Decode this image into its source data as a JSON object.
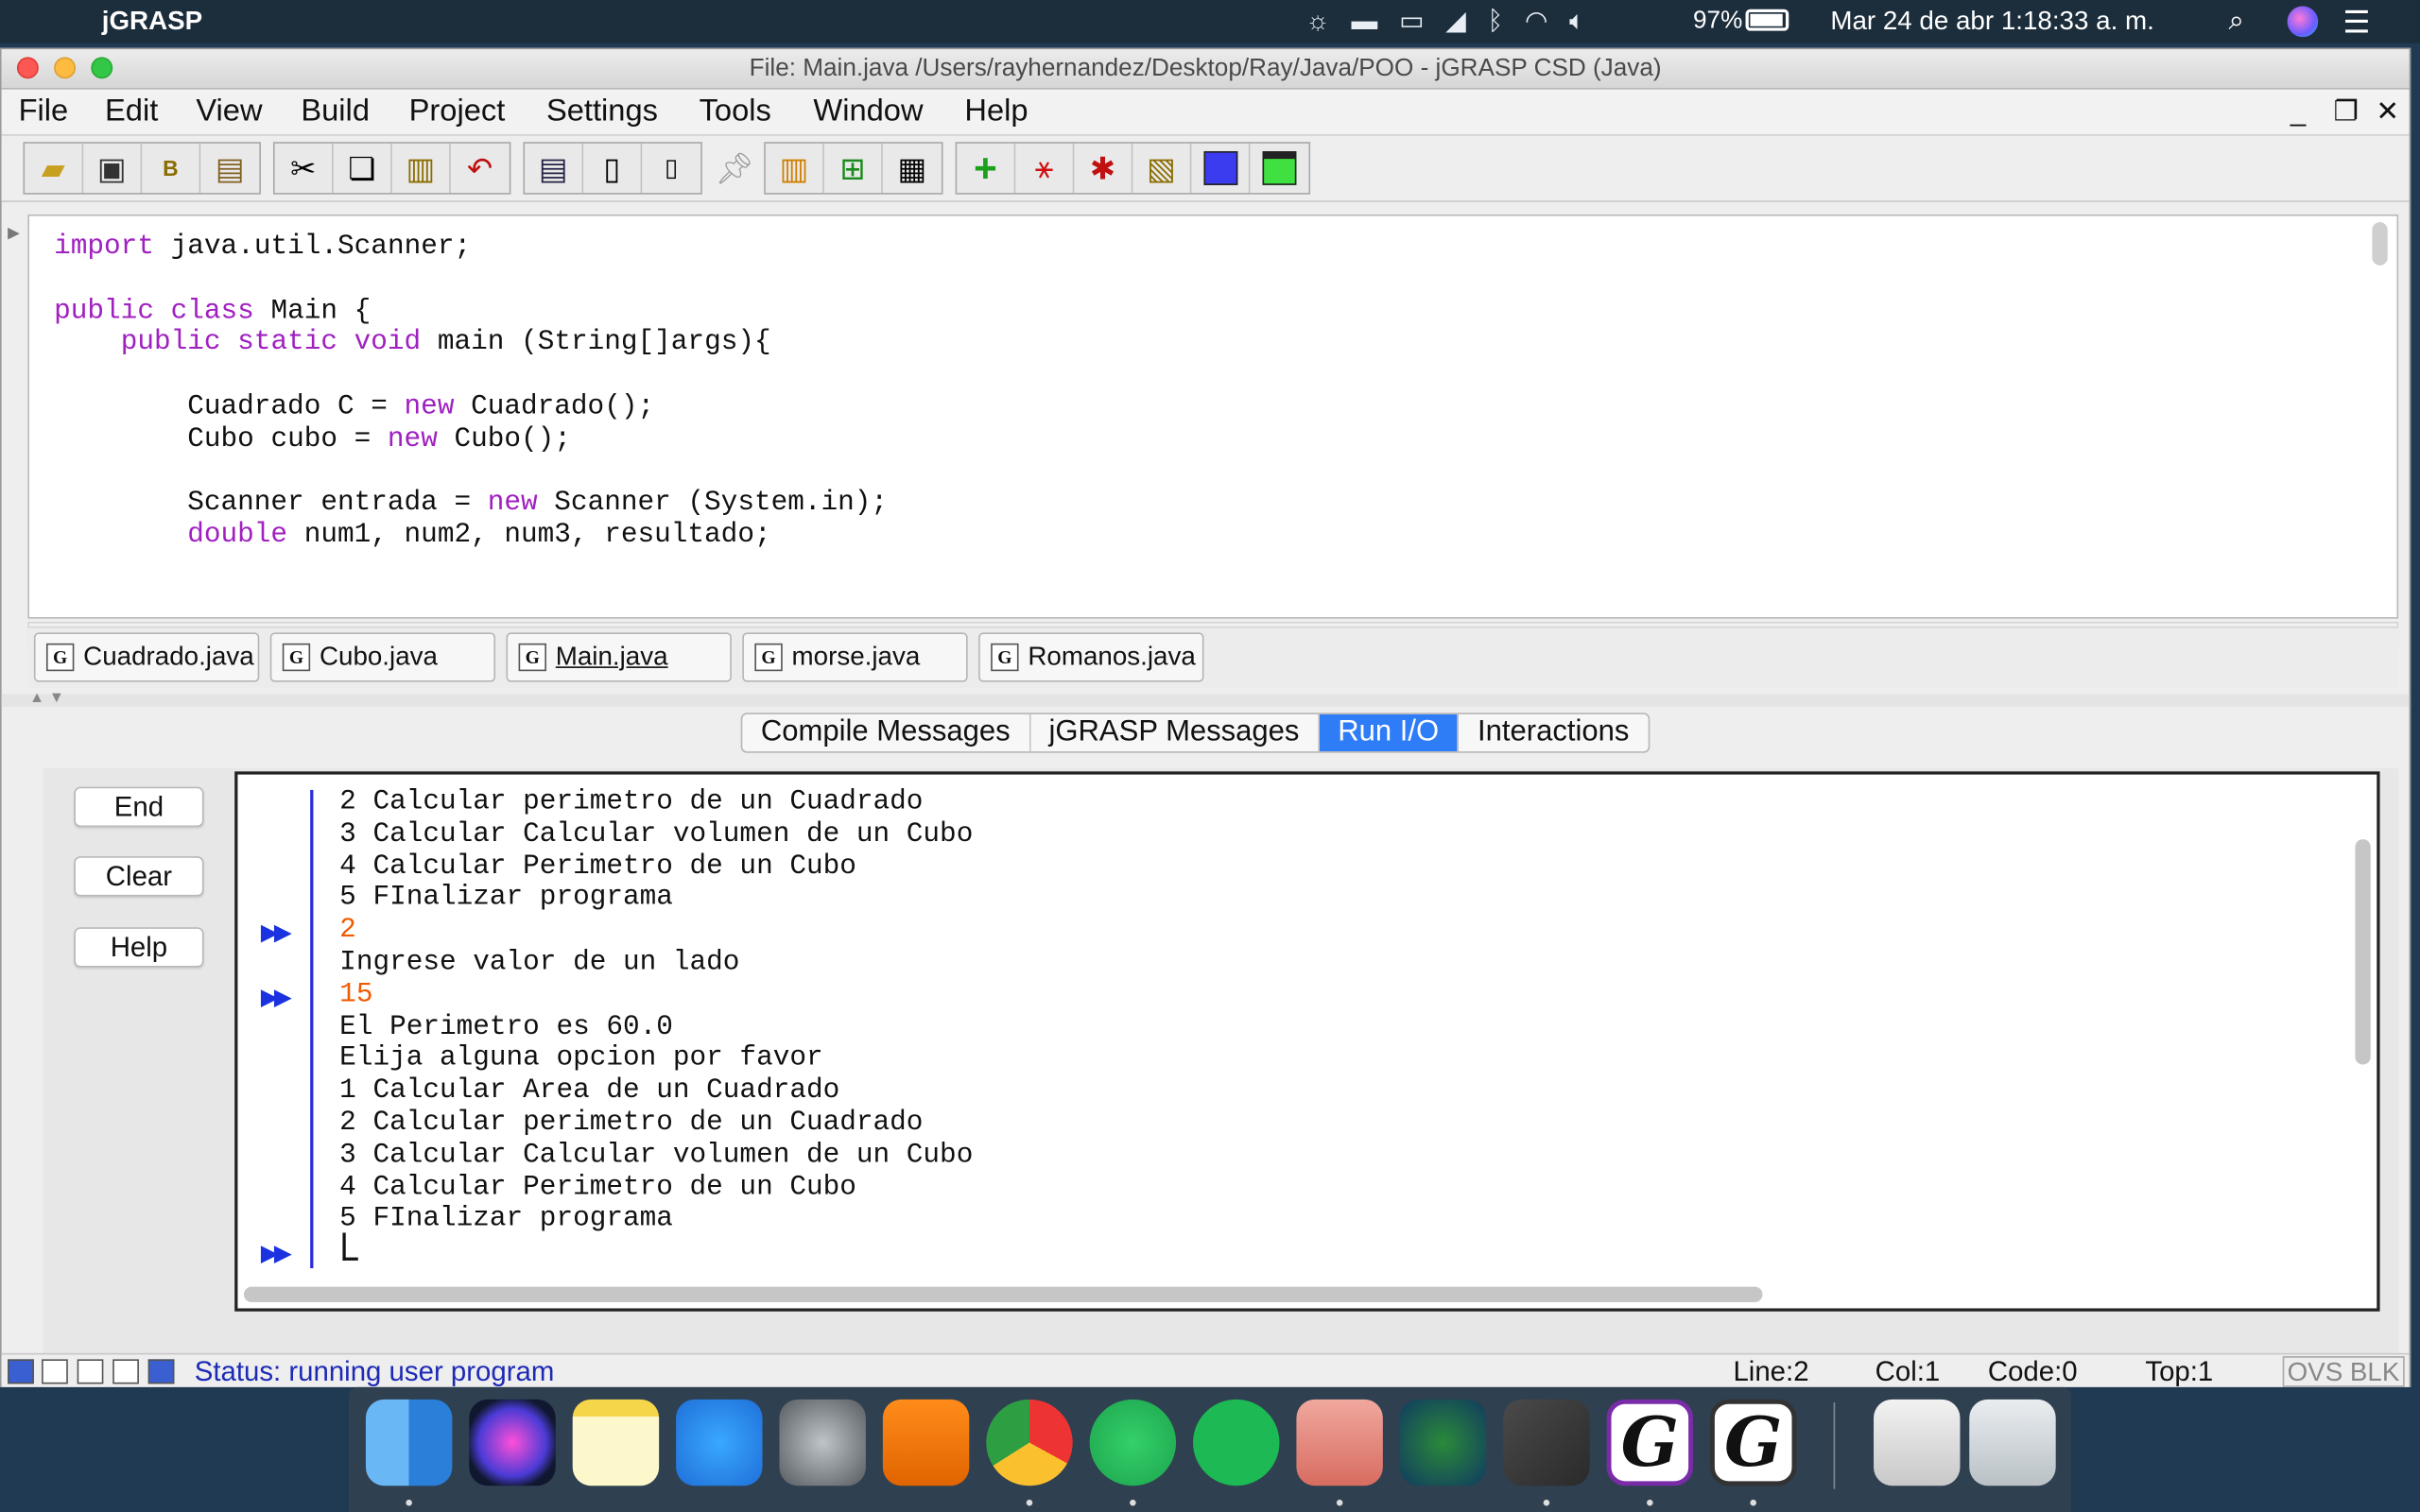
{
  "menubar": {
    "app_name": "jGRASP",
    "battery": "97%",
    "datetime": "Mar 24 de abr  1:18:33 a. m."
  },
  "window": {
    "title": "File: Main.java  /Users/rayhernandez/Desktop/Ray/Java/POO - jGRASP CSD (Java)"
  },
  "menus": [
    "File",
    "Edit",
    "View",
    "Build",
    "Project",
    "Settings",
    "Tools",
    "Window",
    "Help"
  ],
  "toolbar_icons": [
    "open-icon",
    "save-icon",
    "batch-icon",
    "print-icon",
    "cut-icon",
    "copy-icon",
    "paste-icon",
    "undo-icon",
    "generate-csd-icon",
    "remove-csd-icon",
    "line-numbers-icon",
    "pin-icon",
    "chart-icon",
    "uml-icon",
    "book-icon",
    "compile-icon",
    "run-icon",
    "debug-icon",
    "interactions-icon",
    "blue-square-icon",
    "green-window-icon"
  ],
  "editor": {
    "lines": [
      "import java.util.Scanner;",
      "",
      "public class Main {",
      "    public static void main (String[]args){",
      "",
      "        Cuadrado C = new Cuadrado();",
      "        Cubo cubo = new Cubo();",
      "",
      "        Scanner entrada = new Scanner (System.in);",
      "        double num1, num2, num3, resultado;"
    ]
  },
  "file_tabs": [
    "Cuadrado.java",
    "Cubo.java",
    "Main.java",
    "morse.java",
    "Romanos.java"
  ],
  "active_file_tab": "Main.java",
  "message_tabs": [
    "Compile Messages",
    "jGRASP Messages",
    "Run I/O",
    "Interactions"
  ],
  "active_message_tab": "Run I/O",
  "side_buttons": {
    "end": "End",
    "clear": "Clear",
    "help": "Help"
  },
  "console": {
    "lines": [
      {
        "text": "2 Calcular perimetro de un Cuadrado",
        "input": false
      },
      {
        "text": "3 Calcular Calcular volumen de un Cubo",
        "input": false
      },
      {
        "text": "4 Calcular Perimetro de un Cubo",
        "input": false
      },
      {
        "text": "5 FInalizar programa",
        "input": false
      },
      {
        "text": "2",
        "input": true
      },
      {
        "text": "Ingrese valor de un lado",
        "input": false
      },
      {
        "text": "15",
        "input": true
      },
      {
        "text": "El Perimetro es 60.0",
        "input": false
      },
      {
        "text": "Elija alguna opcion por favor",
        "input": false
      },
      {
        "text": "1 Calcular Area de un Cuadrado",
        "input": false
      },
      {
        "text": "2 Calcular perimetro de un Cuadrado",
        "input": false
      },
      {
        "text": "3 Calcular Calcular volumen de un Cubo",
        "input": false
      },
      {
        "text": "4 Calcular Perimetro de un Cubo",
        "input": false
      },
      {
        "text": "5 FInalizar programa",
        "input": false
      }
    ],
    "marker": "▶▶"
  },
  "status": {
    "text": "Status: running user program",
    "line": "Line:2",
    "col": "Col:1",
    "code": "Code:0",
    "top": "Top:1",
    "mode": "OVS BLK"
  },
  "dock_apps": [
    "finder-icon",
    "siri-icon",
    "notes-icon",
    "app-store-icon",
    "system-preferences-icon",
    "vlc-icon",
    "chrome-icon",
    "whatsapp-icon",
    "spotify-icon",
    "preview-icon",
    "globe-app-icon",
    "sublime-text-icon",
    "jgrasp-icon",
    "jgrasp-icon-2",
    "downloads-icon",
    "trash-icon"
  ]
}
